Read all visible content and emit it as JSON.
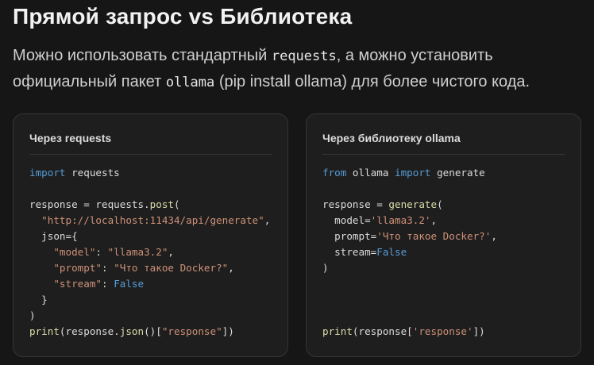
{
  "title": "Прямой запрос vs Библиотека",
  "description": {
    "part1": "Можно использовать стандартный ",
    "code1": "requests",
    "part2": ", а можно установить официальный пакет ",
    "code2": "ollama",
    "part3": " (pip install ollama) для более чистого кода."
  },
  "cards": [
    {
      "title": "Через requests",
      "lines": [
        [
          {
            "t": "import",
            "k": "key"
          },
          {
            "t": " requests",
            "k": "plain"
          }
        ],
        [],
        [
          {
            "t": "response = requests.",
            "k": "plain"
          },
          {
            "t": "post",
            "k": "fn"
          },
          {
            "t": "(",
            "k": "plain"
          }
        ],
        [
          {
            "t": "  ",
            "k": "plain"
          },
          {
            "t": "\"http://localhost:11434/api/generate\"",
            "k": "str"
          },
          {
            "t": ",",
            "k": "plain"
          }
        ],
        [
          {
            "t": "  json={",
            "k": "plain"
          }
        ],
        [
          {
            "t": "    ",
            "k": "plain"
          },
          {
            "t": "\"model\"",
            "k": "str"
          },
          {
            "t": ": ",
            "k": "plain"
          },
          {
            "t": "\"llama3.2\"",
            "k": "str"
          },
          {
            "t": ",",
            "k": "plain"
          }
        ],
        [
          {
            "t": "    ",
            "k": "plain"
          },
          {
            "t": "\"prompt\"",
            "k": "str"
          },
          {
            "t": ": ",
            "k": "plain"
          },
          {
            "t": "\"Что такое Docker?\"",
            "k": "str"
          },
          {
            "t": ",",
            "k": "plain"
          }
        ],
        [
          {
            "t": "    ",
            "k": "plain"
          },
          {
            "t": "\"stream\"",
            "k": "str"
          },
          {
            "t": ": ",
            "k": "plain"
          },
          {
            "t": "False",
            "k": "bool"
          }
        ],
        [
          {
            "t": "  }",
            "k": "plain"
          }
        ],
        [
          {
            "t": ")",
            "k": "plain"
          }
        ],
        [
          {
            "t": "print",
            "k": "fn"
          },
          {
            "t": "(response.",
            "k": "plain"
          },
          {
            "t": "json",
            "k": "fn"
          },
          {
            "t": "()[",
            "k": "plain"
          },
          {
            "t": "\"response\"",
            "k": "str"
          },
          {
            "t": "])",
            "k": "plain"
          }
        ]
      ]
    },
    {
      "title": "Через библиотеку ollama",
      "lines": [
        [
          {
            "t": "from",
            "k": "key"
          },
          {
            "t": " ollama ",
            "k": "plain"
          },
          {
            "t": "import",
            "k": "key"
          },
          {
            "t": " generate",
            "k": "plain"
          }
        ],
        [],
        [
          {
            "t": "response = ",
            "k": "plain"
          },
          {
            "t": "generate",
            "k": "fn"
          },
          {
            "t": "(",
            "k": "plain"
          }
        ],
        [
          {
            "t": "  model=",
            "k": "plain"
          },
          {
            "t": "'llama3.2'",
            "k": "str"
          },
          {
            "t": ",",
            "k": "plain"
          }
        ],
        [
          {
            "t": "  prompt=",
            "k": "plain"
          },
          {
            "t": "'Что такое Docker?'",
            "k": "str"
          },
          {
            "t": ",",
            "k": "plain"
          }
        ],
        [
          {
            "t": "  stream=",
            "k": "plain"
          },
          {
            "t": "False",
            "k": "bool"
          }
        ],
        [
          {
            "t": ")",
            "k": "plain"
          }
        ],
        [],
        [],
        [],
        [
          {
            "t": "print",
            "k": "fn"
          },
          {
            "t": "(response[",
            "k": "plain"
          },
          {
            "t": "'response'",
            "k": "str"
          },
          {
            "t": "])",
            "k": "plain"
          }
        ]
      ]
    }
  ],
  "colors": {
    "background": "#161616",
    "card_background": "#1e1e1e",
    "keyword": "#569cd6",
    "string": "#ce9178",
    "function": "#dcdcaa",
    "text": "#dcdcdc"
  }
}
